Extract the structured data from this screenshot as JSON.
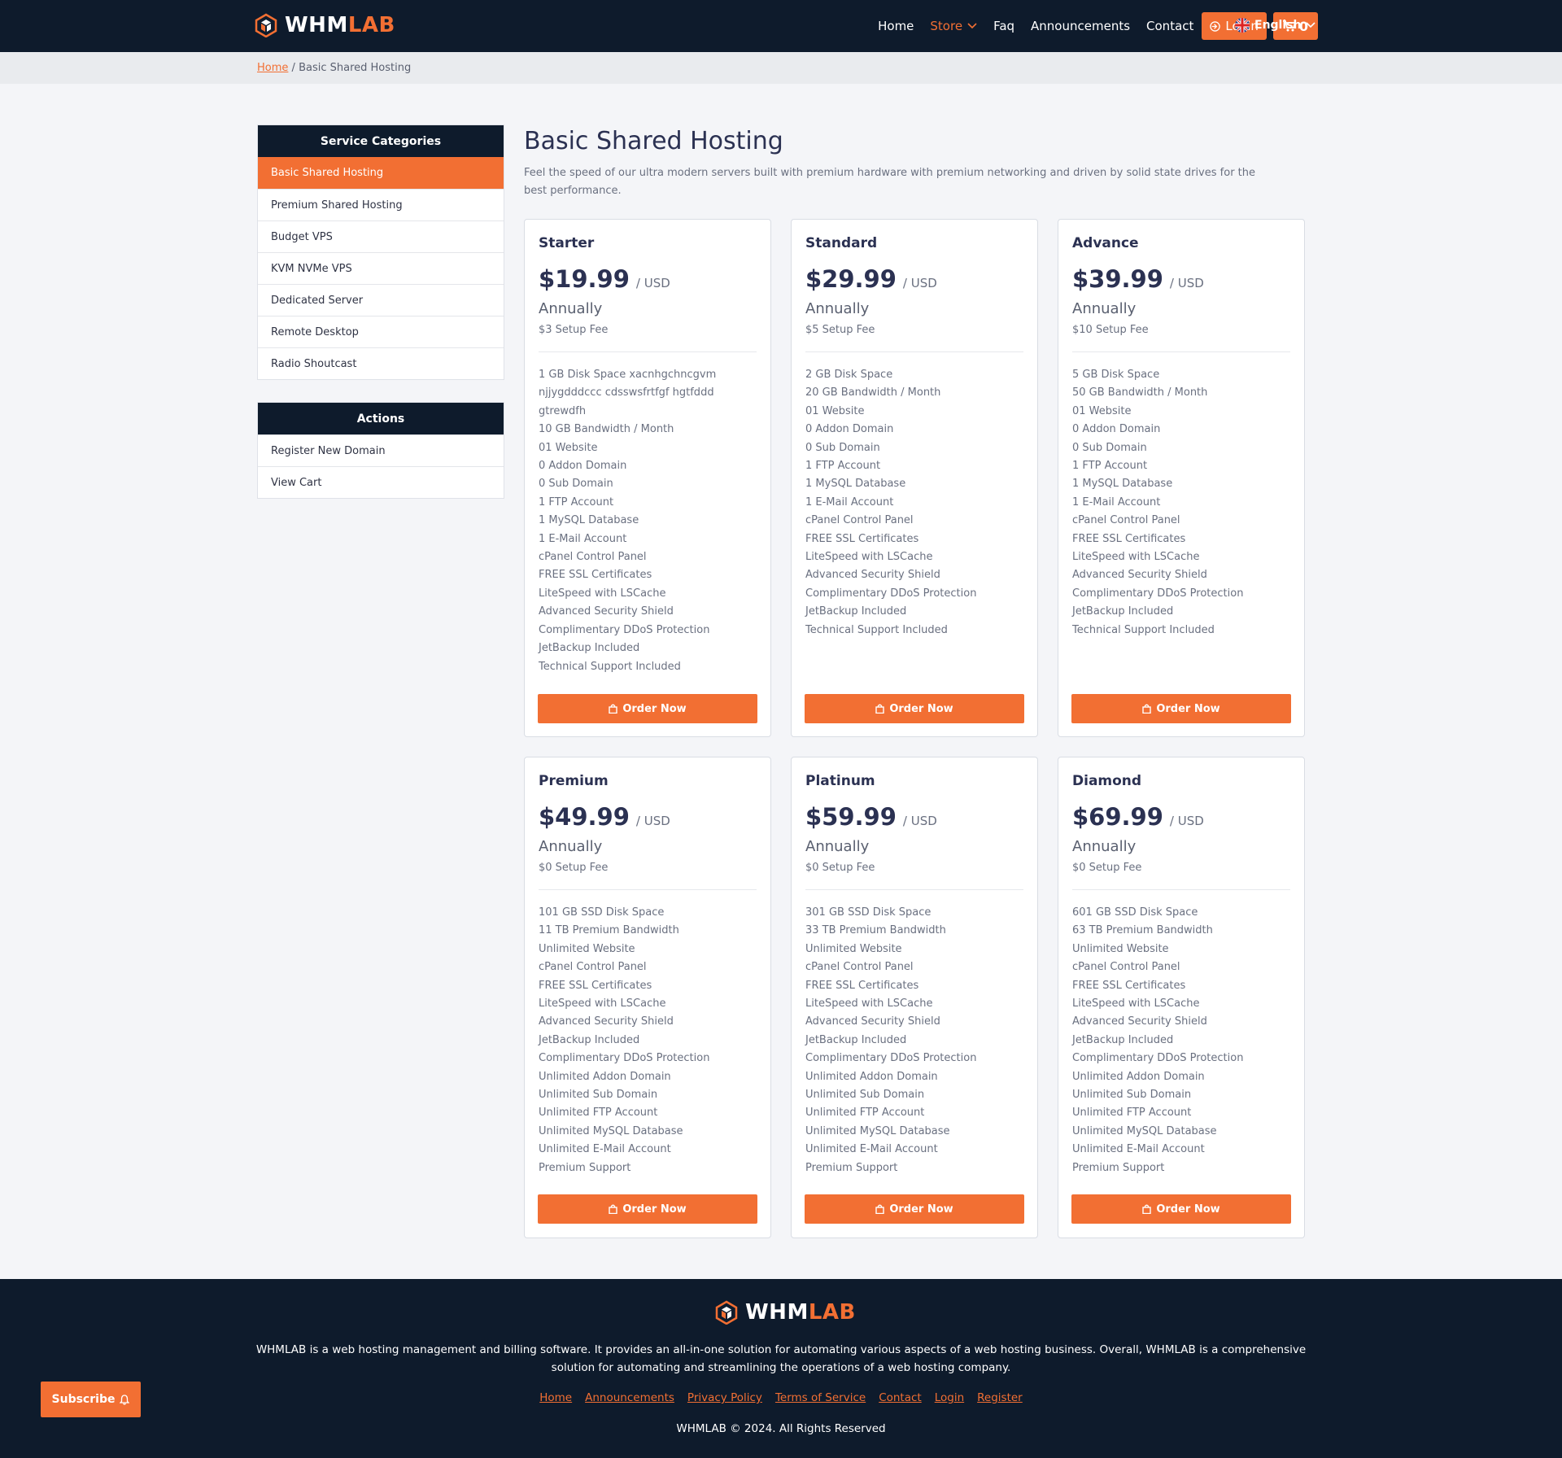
{
  "header": {
    "logo_white": "WHM",
    "logo_orange": "LAB",
    "nav": {
      "home": "Home",
      "store": "Store",
      "faq": "Faq",
      "announcements": "Announcements",
      "contact": "Contact",
      "login": "Login",
      "cart_count": "0",
      "language": "English"
    }
  },
  "breadcrumb": {
    "home": "Home",
    "separator": "/",
    "current": "Basic Shared Hosting"
  },
  "sidebar": {
    "categories_title": "Service Categories",
    "categories": [
      "Basic Shared Hosting",
      "Premium Shared Hosting",
      "Budget VPS",
      "KVM NVMe VPS",
      "Dedicated Server",
      "Remote Desktop",
      "Radio Shoutcast"
    ],
    "active_category": "Basic Shared Hosting",
    "actions_title": "Actions",
    "actions": [
      "Register New Domain",
      "View Cart"
    ]
  },
  "main": {
    "title": "Basic Shared Hosting",
    "description": "Feel the speed of our ultra modern servers built with premium hardware with premium networking and driven by solid state drives for the best performance.",
    "order_label": "Order Now",
    "plans": [
      {
        "name": "Starter",
        "price": "$19.99",
        "currency": "/ USD",
        "cycle": "Annually",
        "setup": "$3 Setup Fee",
        "features": [
          "1 GB Disk Space xacnhgchncgvm",
          "njjygdddccc cdsswsfrtfgf hgtfddd",
          "gtrewdfh",
          "10 GB Bandwidth / Month",
          "01 Website",
          "0 Addon Domain",
          "0 Sub Domain",
          "1 FTP Account",
          "1 MySQL Database",
          "1 E-Mail Account",
          "cPanel Control Panel",
          "FREE SSL Certificates",
          "LiteSpeed with LSCache",
          "Advanced Security Shield",
          "Complimentary DDoS Protection",
          "JetBackup Included",
          "Technical Support Included"
        ]
      },
      {
        "name": "Standard",
        "price": "$29.99",
        "currency": "/ USD",
        "cycle": "Annually",
        "setup": "$5 Setup Fee",
        "features": [
          "2 GB Disk Space",
          "20 GB Bandwidth / Month",
          "01 Website",
          "0 Addon Domain",
          "0 Sub Domain",
          "1 FTP Account",
          "1 MySQL Database",
          "1 E-Mail Account",
          "cPanel Control Panel",
          "FREE SSL Certificates",
          "LiteSpeed with LSCache",
          "Advanced Security Shield",
          "Complimentary DDoS Protection",
          "JetBackup Included",
          "Technical Support Included"
        ]
      },
      {
        "name": "Advance",
        "price": "$39.99",
        "currency": "/ USD",
        "cycle": "Annually",
        "setup": "$10 Setup Fee",
        "features": [
          "5 GB Disk Space",
          "50 GB Bandwidth / Month",
          "01 Website",
          "0 Addon Domain",
          "0 Sub Domain",
          "1 FTP Account",
          "1 MySQL Database",
          "1 E-Mail Account",
          "cPanel Control Panel",
          "FREE SSL Certificates",
          "LiteSpeed with LSCache",
          "Advanced Security Shield",
          "Complimentary DDoS Protection",
          "JetBackup Included",
          "Technical Support Included"
        ]
      },
      {
        "name": "Premium",
        "price": "$49.99",
        "currency": "/ USD",
        "cycle": "Annually",
        "setup": "$0 Setup Fee",
        "features": [
          "101 GB SSD Disk Space",
          "11 TB Premium Bandwidth",
          "Unlimited Website",
          "cPanel Control Panel",
          "FREE SSL Certificates",
          "LiteSpeed with LSCache",
          "Advanced Security Shield",
          "JetBackup Included",
          "Complimentary DDoS Protection",
          "Unlimited Addon Domain",
          "Unlimited Sub Domain",
          "Unlimited FTP Account",
          "Unlimited MySQL Database",
          "Unlimited E-Mail Account",
          "Premium Support"
        ]
      },
      {
        "name": "Platinum",
        "price": "$59.99",
        "currency": "/ USD",
        "cycle": "Annually",
        "setup": "$0 Setup Fee",
        "features": [
          "301 GB SSD Disk Space",
          "33 TB Premium Bandwidth",
          "Unlimited Website",
          "cPanel Control Panel",
          "FREE SSL Certificates",
          "LiteSpeed with LSCache",
          "Advanced Security Shield",
          "JetBackup Included",
          "Complimentary DDoS Protection",
          "Unlimited Addon Domain",
          "Unlimited Sub Domain",
          "Unlimited FTP Account",
          "Unlimited MySQL Database",
          "Unlimited E-Mail Account",
          "Premium Support"
        ]
      },
      {
        "name": "Diamond",
        "price": "$69.99",
        "currency": "/ USD",
        "cycle": "Annually",
        "setup": "$0 Setup Fee",
        "features": [
          "601 GB SSD Disk Space",
          "63 TB Premium Bandwidth",
          "Unlimited Website",
          "cPanel Control Panel",
          "FREE SSL Certificates",
          "LiteSpeed with LSCache",
          "Advanced Security Shield",
          "JetBackup Included",
          "Complimentary DDoS Protection",
          "Unlimited Addon Domain",
          "Unlimited Sub Domain",
          "Unlimited FTP Account",
          "Unlimited MySQL Database",
          "Unlimited E-Mail Account",
          "Premium Support"
        ]
      }
    ]
  },
  "footer": {
    "logo_white": "WHM",
    "logo_orange": "LAB",
    "description": "WHMLAB is a web hosting management and billing software. It provides an all-in-one solution for automating various aspects of a web hosting business. Overall, WHMLAB is a comprehensive solution for automating and streamlining the operations of a web hosting company.",
    "links": [
      "Home",
      "Announcements",
      "Privacy Policy",
      "Terms of Service",
      "Contact",
      "Login",
      "Register"
    ],
    "copyright": "WHMLAB © 2024. All Rights Reserved"
  },
  "subscribe": {
    "label": "Subscribe"
  },
  "colors": {
    "accent": "#f26f33",
    "navy": "#0e1b2c",
    "background": "#f4f5f8"
  },
  "icons": [
    "logo-cube-icon",
    "chevron-down-icon",
    "login-icon",
    "cart-icon",
    "uk-flag-icon",
    "bag-icon",
    "bell-icon"
  ]
}
